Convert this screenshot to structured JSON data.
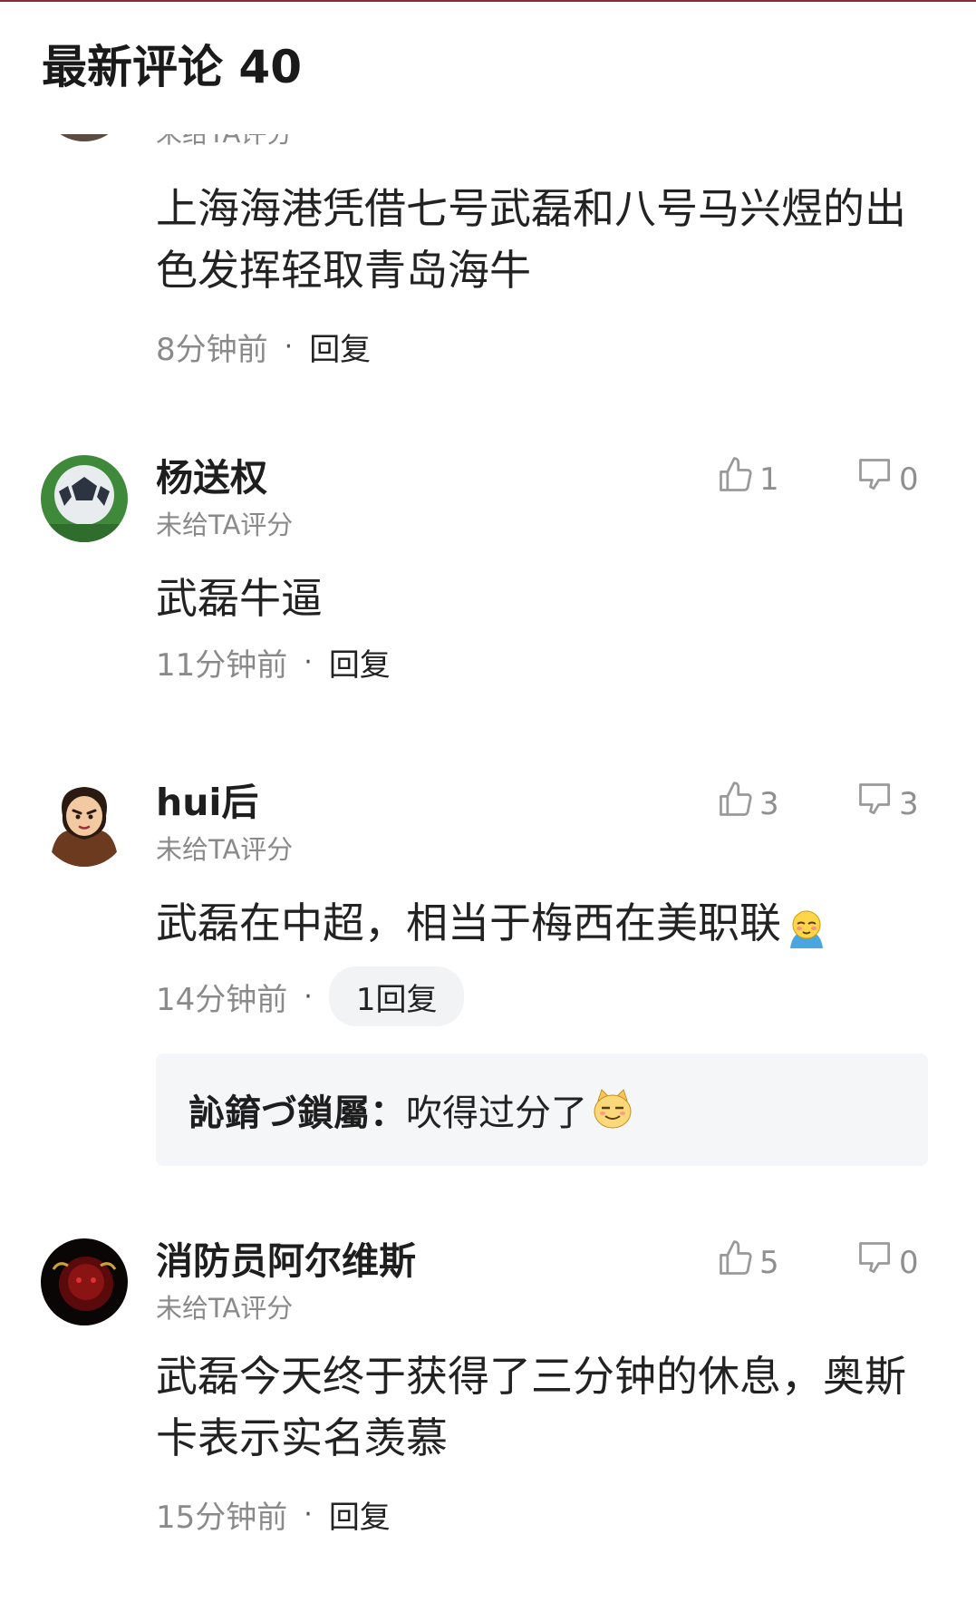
{
  "header": {
    "title": "最新评论 40"
  },
  "comments": [
    {
      "username": "",
      "rating": "未给TA评分",
      "text": "上海海港凭借七号武磊和八号马兴煜的出色发挥轻取青岛海牛",
      "time": "8分钟前",
      "separator": "·",
      "reply_label": "回复"
    },
    {
      "username": "杨送权",
      "rating": "未给TA评分",
      "text": "武磊牛逼",
      "time": "11分钟前",
      "separator": "·",
      "reply_label": "回复",
      "likes": "1",
      "dislikes": "0"
    },
    {
      "username": "hui后",
      "rating": "未给TA评分",
      "text": "武磊在中超，相当于梅西在美职联",
      "time": "14分钟前",
      "separator": "·",
      "reply_label": "1回复",
      "likes": "3",
      "dislikes": "3",
      "sub_reply": {
        "user": "訫錥づ鎖屬：",
        "text": "吹得过分了"
      }
    },
    {
      "username": "消防员阿尔维斯",
      "rating": "未给TA评分",
      "text": "武磊今天终于获得了三分钟的休息，奥斯卡表示实名羡慕",
      "time": "15分钟前",
      "separator": "·",
      "reply_label": "回复",
      "likes": "5",
      "dislikes": "0"
    }
  ],
  "icons": {
    "like": "thumbs-up-outline-icon",
    "dislike": "thumbs-down-outline-icon",
    "emoji_1": "blushing-face-emoji",
    "emoji_2": "smug-cat-emoji"
  },
  "colors": {
    "accent_line": "#8c2a3a",
    "muted": "#8a8a8a",
    "sub_reply_bg": "#f5f6f8"
  }
}
